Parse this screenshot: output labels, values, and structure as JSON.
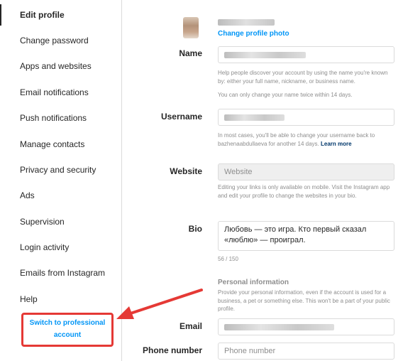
{
  "sidebar": {
    "items": [
      {
        "label": "Edit profile",
        "active": true
      },
      {
        "label": "Change password"
      },
      {
        "label": "Apps and websites"
      },
      {
        "label": "Email notifications"
      },
      {
        "label": "Push notifications"
      },
      {
        "label": "Manage contacts"
      },
      {
        "label": "Privacy and security"
      },
      {
        "label": "Ads"
      },
      {
        "label": "Supervision"
      },
      {
        "label": "Login activity"
      },
      {
        "label": "Emails from Instagram"
      },
      {
        "label": "Help"
      }
    ],
    "switch_professional": "Switch to professional account"
  },
  "profile": {
    "change_photo": "Change profile photo"
  },
  "form": {
    "name_label": "Name",
    "name_help_1": "Help people discover your account by using the name you're known by: either your full name, nickname, or business name.",
    "name_help_2": "You can only change your name twice within 14 days.",
    "username_label": "Username",
    "username_help": "In most cases, you'll be able to change your username back to bazhenaabdullaeva for another 14 days.",
    "username_help_link": "Learn more",
    "website_label": "Website",
    "website_placeholder": "Website",
    "website_help": "Editing your links is only available on mobile. Visit the Instagram app and edit your profile to change the websites in your bio.",
    "bio_label": "Bio",
    "bio_value": "Любовь — это игра. Кто первый сказал «люблю» — проиграл.",
    "bio_counter": "56 / 150",
    "personal_title": "Personal information",
    "personal_help": "Provide your personal information, even if the account is used for a business, a pet or something else. This won't be a part of your public profile.",
    "email_label": "Email",
    "phone_label": "Phone number",
    "phone_placeholder": "Phone number"
  },
  "colors": {
    "accent": "#0095f6",
    "annotation": "#e53935"
  }
}
